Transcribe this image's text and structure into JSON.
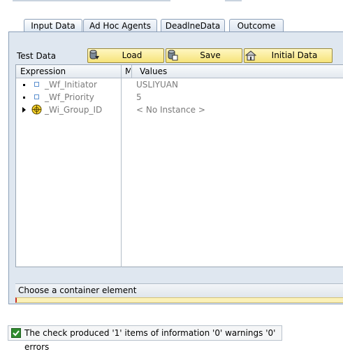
{
  "tabs": [
    {
      "label": "Input Data",
      "active": true
    },
    {
      "label": "Ad Hoc Agents",
      "active": false
    },
    {
      "label": "DeadlneData",
      "active": false
    },
    {
      "label": "Outcome",
      "active": false
    }
  ],
  "toolbar": {
    "test_data_label": "Test Data",
    "buttons": [
      {
        "label": "Load",
        "icon": "load-icon"
      },
      {
        "label": "Save",
        "icon": "save-icon"
      },
      {
        "label": "Initial Data",
        "icon": "initial-data-icon"
      }
    ]
  },
  "tree": {
    "columns": [
      "Expression",
      "M",
      "Values"
    ],
    "rows": [
      {
        "name": "_Wf_Initiator",
        "value": "USLIYUAN",
        "icon": "element-icon",
        "expandable": false
      },
      {
        "name": "_Wf_Priority",
        "value": "5",
        "icon": "element-icon",
        "expandable": false
      },
      {
        "name": "_Wi_Group_ID",
        "value": "< No Instance >",
        "icon": "object-icon",
        "expandable": true
      }
    ]
  },
  "message_bar": {
    "text": "Choose a container element"
  },
  "status": {
    "text": "The check produced '1' items of information '0' warnings '0' errors",
    "icon": "check-icon"
  },
  "colors": {
    "panel": "#dfe7f0",
    "button": "#f6e47a",
    "input_strip": "#fbf1b8",
    "check": "#2e8b2e"
  }
}
